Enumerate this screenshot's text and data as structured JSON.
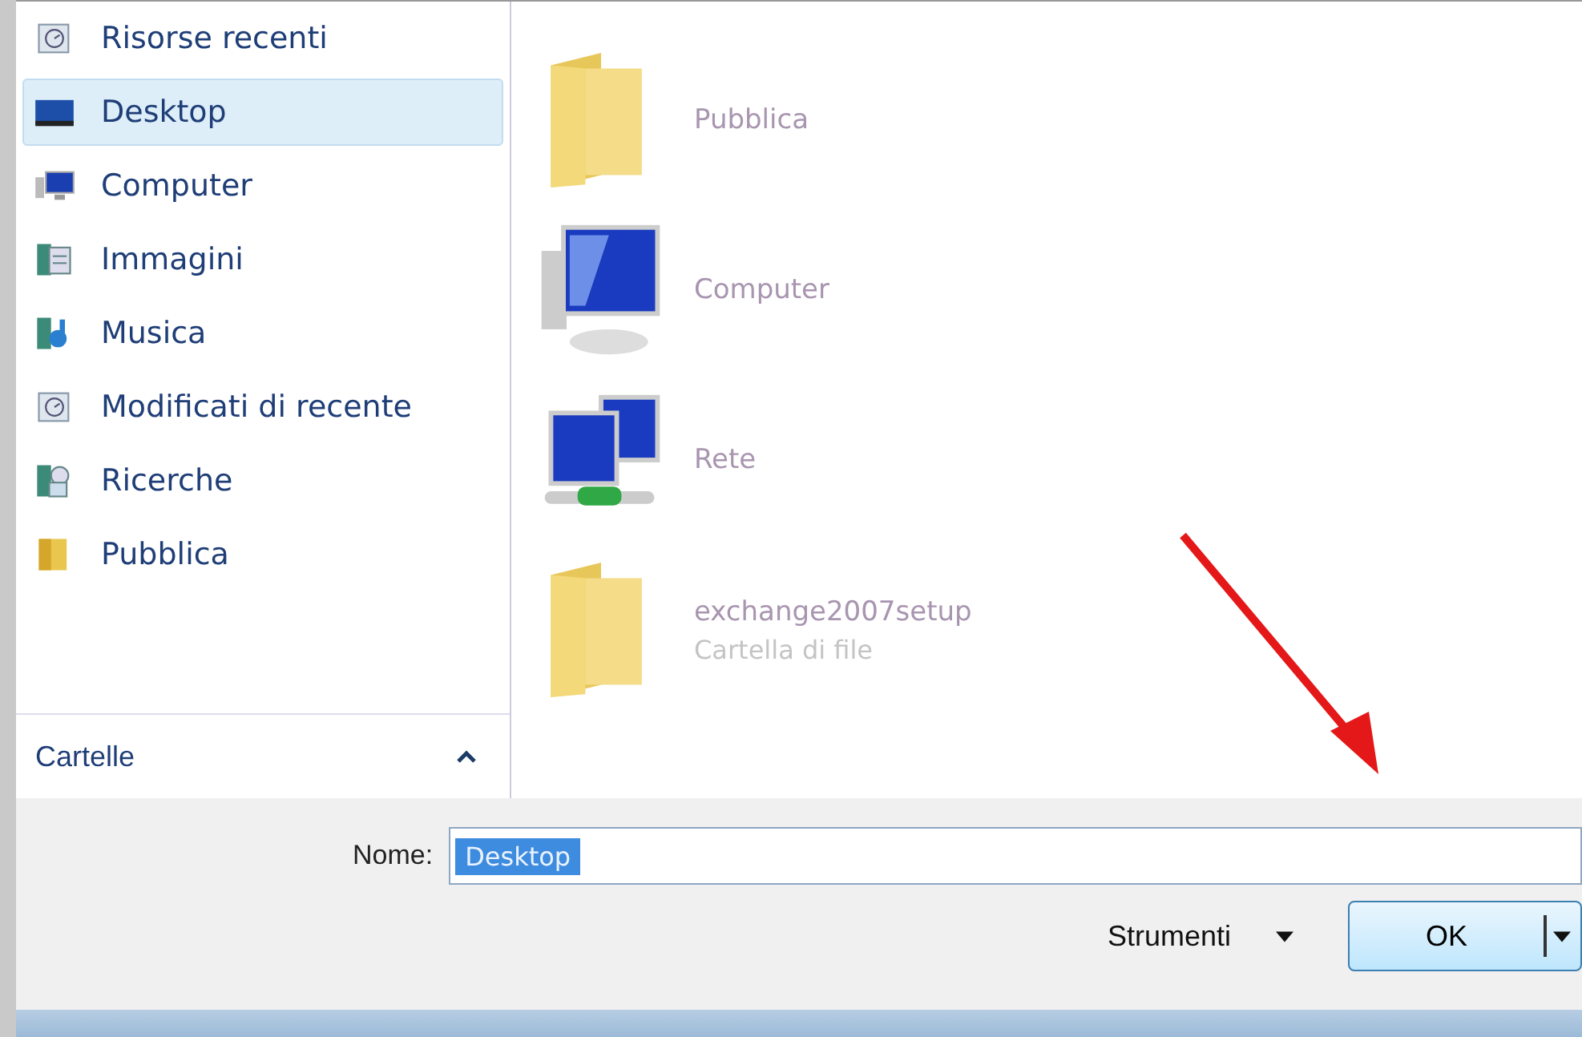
{
  "sidebar": {
    "items": [
      {
        "label": "Risorse recenti",
        "kind": "recent",
        "selected": false
      },
      {
        "label": "Desktop",
        "kind": "desktop",
        "selected": true
      },
      {
        "label": "Computer",
        "kind": "computer",
        "selected": false
      },
      {
        "label": "Immagini",
        "kind": "pictures",
        "selected": false
      },
      {
        "label": "Musica",
        "kind": "music",
        "selected": false
      },
      {
        "label": "Modificati di recente",
        "kind": "recent",
        "selected": false
      },
      {
        "label": "Ricerche",
        "kind": "search",
        "selected": false
      },
      {
        "label": "Pubblica",
        "kind": "folder",
        "selected": false
      }
    ],
    "folders_toggle": {
      "label": "Cartelle",
      "expanded": true
    }
  },
  "files": [
    {
      "name": "Pubblica",
      "kind": "folder"
    },
    {
      "name": "Computer",
      "kind": "computer"
    },
    {
      "name": "Rete",
      "kind": "network"
    },
    {
      "name": "exchange2007setup",
      "type": "Cartella di file",
      "kind": "folder"
    }
  ],
  "name_field": {
    "label": "Nome:",
    "value": "Desktop"
  },
  "tools": {
    "label": "Strumenti"
  },
  "ok_button": {
    "label": "OK"
  }
}
